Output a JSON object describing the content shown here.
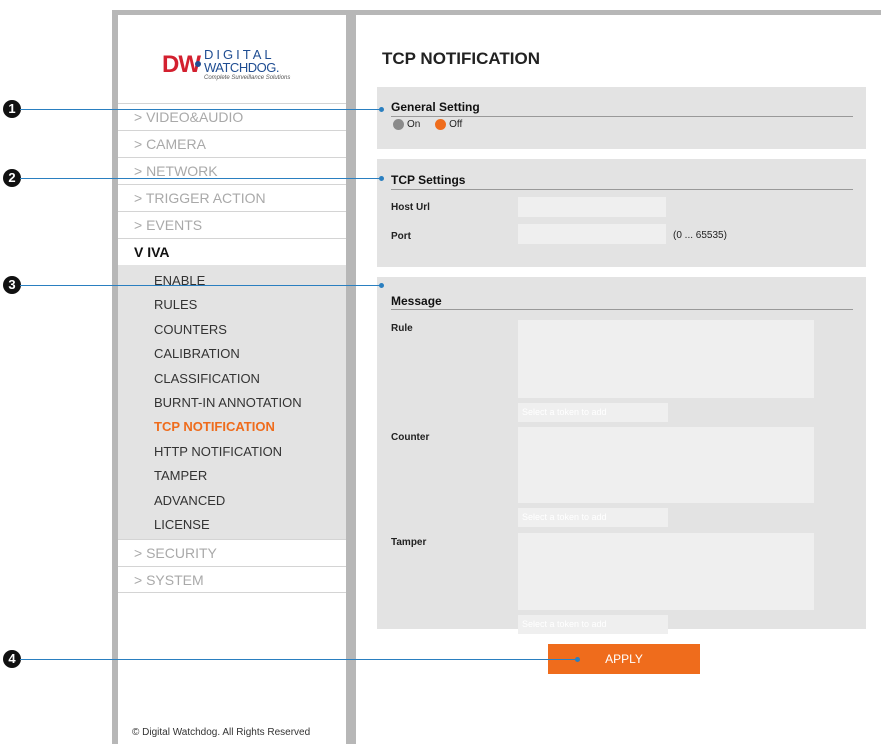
{
  "brand": {
    "logo_mark": "DW",
    "line1": "DIGITAL",
    "line2": "WATCHDOG.",
    "tagline": "Complete Surveillance Solutions"
  },
  "menu": {
    "before": [
      "> VIDEO&AUDIO",
      "> CAMERA",
      "> NETWORK",
      "> TRIGGER ACTION",
      "> EVENTS"
    ],
    "open_label": "V IVA",
    "sub_items": [
      "ENABLE",
      "RULES",
      "COUNTERS",
      "CALIBRATION",
      "CLASSIFICATION",
      "BURNT-IN ANNOTATION",
      "TCP NOTIFICATION",
      "HTTP NOTIFICATION",
      "TAMPER",
      "ADVANCED",
      "LICENSE"
    ],
    "active_sub": "TCP NOTIFICATION",
    "after": [
      "> SECURITY",
      "> SYSTEM"
    ]
  },
  "footer": {
    "copyright": "© Digital Watchdog. All Rights Reserved"
  },
  "page": {
    "title": "TCP NOTIFICATION"
  },
  "general": {
    "title": "General Setting",
    "on_label": "On",
    "off_label": "Off",
    "selected": "Off"
  },
  "tcp": {
    "title": "TCP Settings",
    "host_label": "Host Url",
    "host_value": "",
    "port_label": "Port",
    "port_value": "",
    "port_range": "(0 ... 65535)"
  },
  "message": {
    "title": "Message",
    "rule_label": "Rule",
    "counter_label": "Counter",
    "tamper_label": "Tamper",
    "token_placeholder": "Select a token to add"
  },
  "apply_label": "APPLY",
  "callouts": [
    "1",
    "2",
    "3",
    "4"
  ],
  "colors": {
    "accent": "#ef6c1c",
    "callout_line": "#2a7fc0",
    "panel": "#e3e3e3"
  }
}
